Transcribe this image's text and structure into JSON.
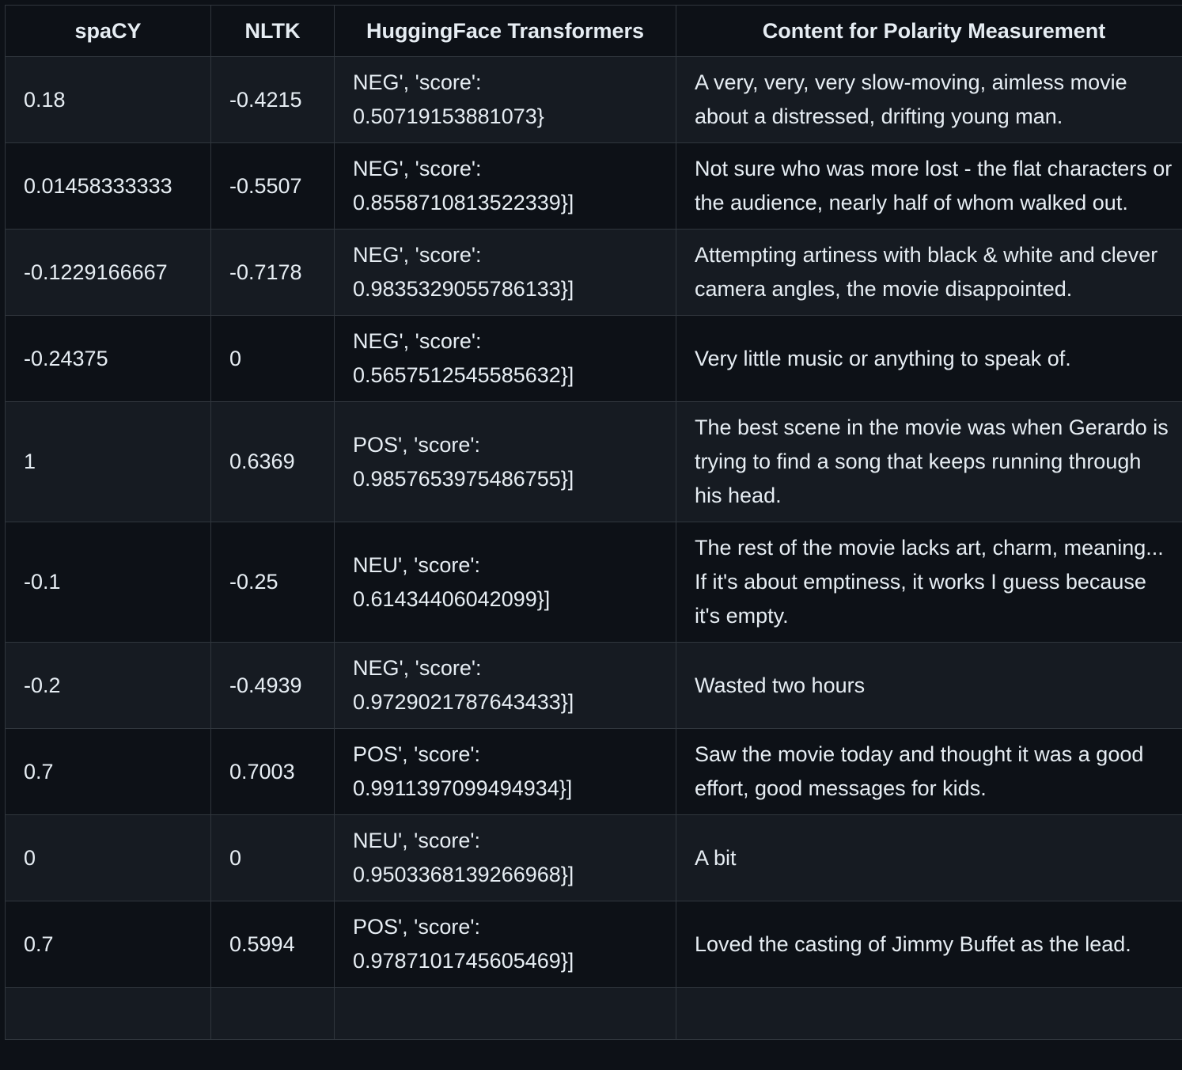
{
  "table": {
    "headers": [
      "spaCY",
      "NLTK",
      "HuggingFace Transformers",
      "Content for Polarity Measurement"
    ],
    "rows": [
      {
        "spacy": "0.18",
        "nltk": "-0.4215",
        "hf_label": "NEG', 'score':",
        "hf_score": "0.50719153881073}",
        "content": "A very, very, very slow-moving, aimless movie about a distressed, drifting young man."
      },
      {
        "spacy": "0.01458333333",
        "nltk": "-0.5507",
        "hf_label": "NEG', 'score':",
        "hf_score": "0.8558710813522339}]",
        "content": "Not sure who was more lost - the flat characters or the audience, nearly half of whom walked out."
      },
      {
        "spacy": "-0.1229166667",
        "nltk": "-0.7178",
        "hf_label": "NEG', 'score':",
        "hf_score": "0.9835329055786133}]",
        "content": "Attempting artiness with black & white and clever camera angles, the movie disappointed."
      },
      {
        "spacy": "-0.24375",
        "nltk": "0",
        "hf_label": "NEG', 'score':",
        "hf_score": "0.5657512545585632}]",
        "content": "Very little music or anything to speak of."
      },
      {
        "spacy": "1",
        "nltk": "0.6369",
        "hf_label": "POS', 'score':",
        "hf_score": "0.9857653975486755}]",
        "content": "The best scene in the movie was when Gerardo is trying to find a song that keeps running through his head."
      },
      {
        "spacy": "-0.1",
        "nltk": "-0.25",
        "hf_label": "NEU', 'score':",
        "hf_score": "0.61434406042099}]",
        "content": "The rest of the movie lacks art, charm, meaning... If it's about emptiness, it works I guess because it's empty."
      },
      {
        "spacy": "-0.2",
        "nltk": "-0.4939",
        "hf_label": "NEG', 'score':",
        "hf_score": "0.9729021787643433}]",
        "content": "Wasted two hours"
      },
      {
        "spacy": "0.7",
        "nltk": "0.7003",
        "hf_label": "POS', 'score':",
        "hf_score": "0.9911397099494934}]",
        "content": "Saw the movie today and thought it was a good effort, good messages for kids."
      },
      {
        "spacy": "0",
        "nltk": "0",
        "hf_label": "NEU', 'score':",
        "hf_score": "0.9503368139266968}]",
        "content": "A bit"
      },
      {
        "spacy": "0.7",
        "nltk": "0.5994",
        "hf_label": "POS', 'score':",
        "hf_score": "0.9787101745605469}]",
        "content": "Loved the casting of Jimmy Buffet as the lead."
      }
    ]
  }
}
